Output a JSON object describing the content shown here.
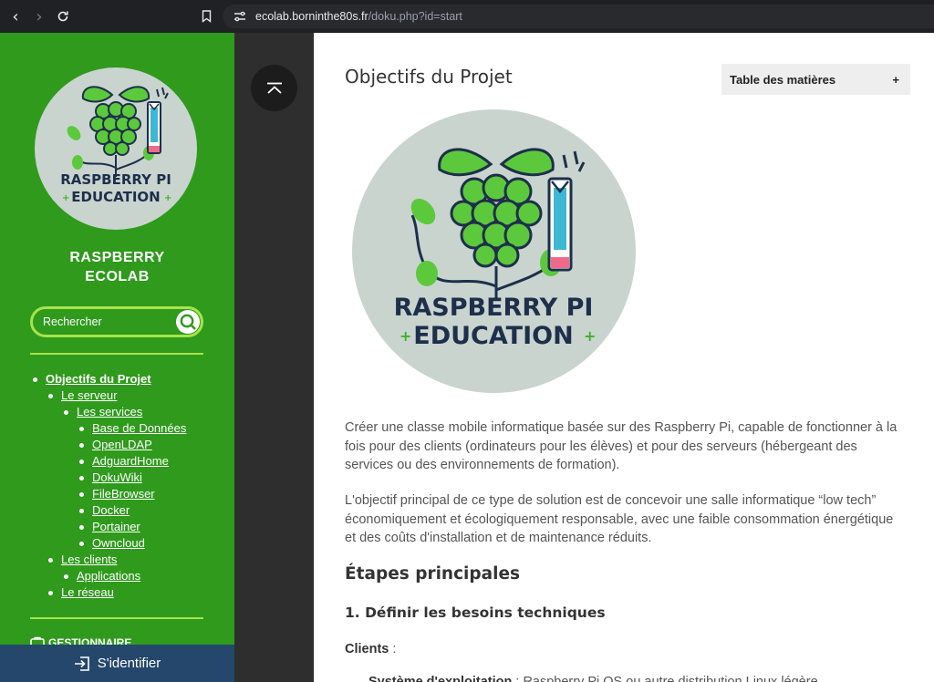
{
  "browser": {
    "url_host": "ecolab.borninthe80s.fr",
    "url_path": "/doku.php?id=start"
  },
  "sidebar": {
    "site_title_line1": "RASPBERRY",
    "site_title_line2": "ECOLAB",
    "search_placeholder": "Rechercher",
    "toc": [
      {
        "label": "Objectifs du Projet",
        "level": 1,
        "bold": true
      },
      {
        "label": "Le serveur",
        "level": 2
      },
      {
        "label": "Les services",
        "level": 3
      },
      {
        "label": "Base de Données",
        "level": 4
      },
      {
        "label": "OpenLDAP",
        "level": 4
      },
      {
        "label": "AdguardHome",
        "level": 4
      },
      {
        "label": "DokuWiki",
        "level": 4
      },
      {
        "label": "FileBrowser",
        "level": 4
      },
      {
        "label": "Docker",
        "level": 4
      },
      {
        "label": "Portainer",
        "level": 4
      },
      {
        "label": "Owncloud",
        "level": 4
      },
      {
        "label": "Les clients",
        "level": 2
      },
      {
        "label": "Applications",
        "level": 3
      },
      {
        "label": "Le réseau",
        "level": 2
      }
    ],
    "gestionnaire_label": "GESTIONNAIRE",
    "login_label": "S'identifier"
  },
  "logo": {
    "line1": "RASPBERRY PI",
    "line2": "EDUCATION"
  },
  "main": {
    "title": "Objectifs du Projet",
    "toc_box_label": "Table des matières",
    "toc_box_toggle": "+",
    "para1": "Créer une classe mobile informatique basée sur des Raspberry Pi, capable de fonctionner à la fois pour des clients (ordinateurs pour les élèves) et pour des serveurs (hébergeant des services ou des environnements de formation).",
    "para2": "L'objectif principal de ce type de solution est de concevoir une salle informatique “low tech” économiquement et écologiquement responsable, avec une faible consommation énergétique et des coûts d'installation et de maintenance réduits.",
    "h2": "Étapes principales",
    "h3": "1. Définir les besoins techniques",
    "clients_label": "Clients",
    "clients_suffix": " :",
    "cut_bold": "Système d'exploitation",
    "cut_rest": " : Raspberry Pi OS ou autre distribution Linux légère"
  },
  "colors": {
    "sidebar_green": "#2f9a1c",
    "accent_lime": "#a9e34b",
    "login_blue": "#24476b"
  }
}
